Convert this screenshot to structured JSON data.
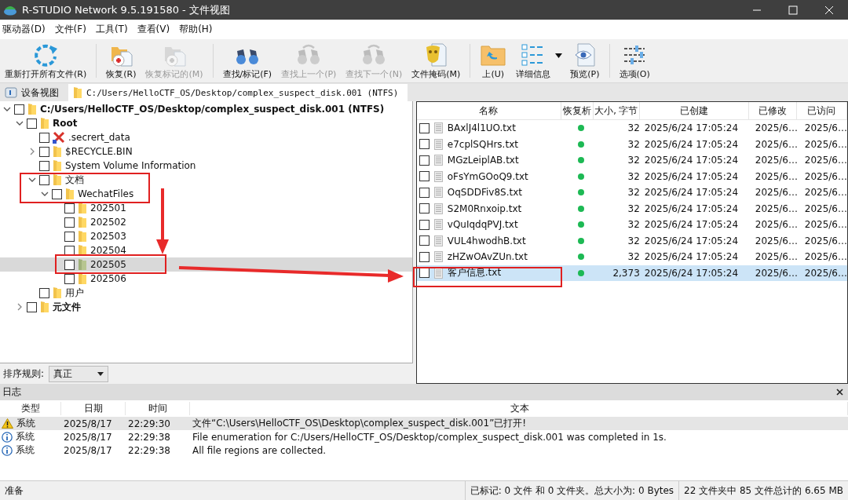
{
  "window": {
    "title": "R-STUDIO Network 9.5.191580 - 文件视图"
  },
  "menu": [
    "驱动器(D)",
    "文件(F)",
    "工具(T)",
    "查看(V)",
    "帮助(H)"
  ],
  "toolbar": [
    {
      "label": "重新打开所有文件(R)",
      "disabled": false,
      "separator_after": true
    },
    {
      "label": "恢复(R)",
      "disabled": false
    },
    {
      "label": "恢复标记的(M)",
      "disabled": true,
      "separator_after": true
    },
    {
      "label": "查找/标记(F)",
      "disabled": false
    },
    {
      "label": "查找上一个(P)",
      "disabled": true
    },
    {
      "label": "查找下一个(N)",
      "disabled": true
    },
    {
      "label": "文件掩码(M)",
      "disabled": false,
      "separator_after": true
    },
    {
      "label": "上(U)",
      "disabled": false
    },
    {
      "label": "详细信息",
      "disabled": false,
      "dropdown": true
    },
    {
      "label": "预览(P)",
      "disabled": false,
      "separator_after": true
    },
    {
      "label": "选项(O)",
      "disabled": false
    }
  ],
  "tabs": [
    {
      "label": "设备视图",
      "selected": false
    },
    {
      "label": "C:/Users/HelloCTF_OS/Desktop/complex_suspect_disk.001 (NTFS)",
      "selected": true
    }
  ],
  "tree": [
    {
      "label": "C:/Users/HelloCTF_OS/Desktop/complex_suspect_disk.001 (NTFS)",
      "kind": "drive",
      "checked": false,
      "selected": false,
      "expanded": true,
      "children": [
        {
          "label": "Root",
          "kind": "root",
          "checked": false,
          "selected": false,
          "expanded": true,
          "children": [
            {
              "label": ".secrert_data",
              "kind": "deleted",
              "checked": false,
              "selected": false
            },
            {
              "label": "$RECYCLE.BIN",
              "kind": "folder",
              "checked": false,
              "selected": false,
              "expanded": false
            },
            {
              "label": "System Volume Information",
              "kind": "folder",
              "checked": false,
              "selected": false
            },
            {
              "label": "文档",
              "kind": "folder",
              "checked": false,
              "selected": false,
              "expanded": true,
              "children": [
                {
                  "label": "WechatFiles",
                  "kind": "folder",
                  "checked": false,
                  "selected": false,
                  "expanded": true,
                  "children": [
                    {
                      "label": "202501",
                      "kind": "folder",
                      "checked": false,
                      "selected": false
                    },
                    {
                      "label": "202502",
                      "kind": "folder",
                      "checked": false,
                      "selected": false
                    },
                    {
                      "label": "202503",
                      "kind": "folder",
                      "checked": false,
                      "selected": false
                    },
                    {
                      "label": "202504",
                      "kind": "folder",
                      "checked": false,
                      "selected": false
                    },
                    {
                      "label": "202505",
                      "kind": "folder",
                      "checked": false,
                      "selected": true
                    },
                    {
                      "label": "202506",
                      "kind": "folder",
                      "checked": false,
                      "selected": false
                    }
                  ]
                }
              ]
            },
            {
              "label": "用户",
              "kind": "folder",
              "checked": false,
              "selected": false
            }
          ]
        },
        {
          "label": "元文件",
          "kind": "root",
          "checked": false,
          "selected": false,
          "expanded": false
        }
      ]
    }
  ],
  "sort": {
    "label": "排序规则:",
    "value": "真正"
  },
  "files": {
    "columns": [
      "名称",
      "恢复析",
      "大小, 字节",
      "已创建",
      "已修改",
      "已访问"
    ],
    "rows": [
      {
        "name": "BAxlJ4l1UO.txt",
        "checked": false,
        "selected": false,
        "color": "#1db954",
        "size": "32",
        "created": "2025/6/24 17:05:24",
        "modified": "2025/6…",
        "accessed": "2025/6…"
      },
      {
        "name": "e7cplSQHrs.txt",
        "checked": false,
        "selected": false,
        "color": "#1db954",
        "size": "32",
        "created": "2025/6/24 17:05:24",
        "modified": "2025/6…",
        "accessed": "2025/6…"
      },
      {
        "name": "MGzLeiplAB.txt",
        "checked": false,
        "selected": false,
        "color": "#1db954",
        "size": "32",
        "created": "2025/6/24 17:05:24",
        "modified": "2025/6…",
        "accessed": "2025/6…"
      },
      {
        "name": "oFsYmGOoQ9.txt",
        "checked": false,
        "selected": false,
        "color": "#1db954",
        "size": "32",
        "created": "2025/6/24 17:05:24",
        "modified": "2025/6…",
        "accessed": "2025/6…"
      },
      {
        "name": "OqSDDFiv8S.txt",
        "checked": false,
        "selected": false,
        "color": "#1db954",
        "size": "32",
        "created": "2025/6/24 17:05:24",
        "modified": "2025/6…",
        "accessed": "2025/6…"
      },
      {
        "name": "S2M0Rnxoip.txt",
        "checked": false,
        "selected": false,
        "color": "#1db954",
        "size": "32",
        "created": "2025/6/24 17:05:24",
        "modified": "2025/6…",
        "accessed": "2025/6…"
      },
      {
        "name": "vQuIqdqPVJ.txt",
        "checked": false,
        "selected": false,
        "color": "#1db954",
        "size": "32",
        "created": "2025/6/24 17:05:24",
        "modified": "2025/6…",
        "accessed": "2025/6…"
      },
      {
        "name": "VUL4hwodhB.txt",
        "checked": false,
        "selected": false,
        "color": "#1db954",
        "size": "32",
        "created": "2025/6/24 17:05:24",
        "modified": "2025/6…",
        "accessed": "2025/6…"
      },
      {
        "name": "zHZwOAvZUn.txt",
        "checked": false,
        "selected": false,
        "color": "#1db954",
        "size": "32",
        "created": "2025/6/24 17:05:24",
        "modified": "2025/6…",
        "accessed": "2025/6…"
      },
      {
        "name": "客户信息.txt",
        "checked": false,
        "selected": true,
        "color": "#1db954",
        "size": "2,373",
        "created": "2025/6/24 17:05:24",
        "modified": "2025/6…",
        "accessed": "2025/6…"
      }
    ]
  },
  "log": {
    "title": "日志",
    "columns": [
      "类型",
      "日期",
      "时间",
      "文本"
    ],
    "rows": [
      {
        "kind": "warning",
        "selected": true,
        "type": "系统",
        "date": "2025/8/17",
        "time": "22:29:30",
        "text": "文件“C:\\Users\\HelloCTF_OS\\Desktop\\complex_suspect_disk.001”已打开!"
      },
      {
        "kind": "info",
        "selected": false,
        "type": "系统",
        "date": "2025/8/17",
        "time": "22:29:38",
        "text": "File enumeration for C:/Users/HelloCTF_OS/Desktop/complex_suspect_disk.001 was completed in 1s."
      },
      {
        "kind": "info",
        "selected": false,
        "type": "系统",
        "date": "2025/8/17",
        "time": "22:29:38",
        "text": "All file regions are collected."
      }
    ]
  },
  "status_bar": [
    "准备",
    "已标记: 0 文件 和 0 文件夹。总大小为: 0 Bytes",
    "22 文件夹中 85 文件总计的 6.65 MB"
  ]
}
